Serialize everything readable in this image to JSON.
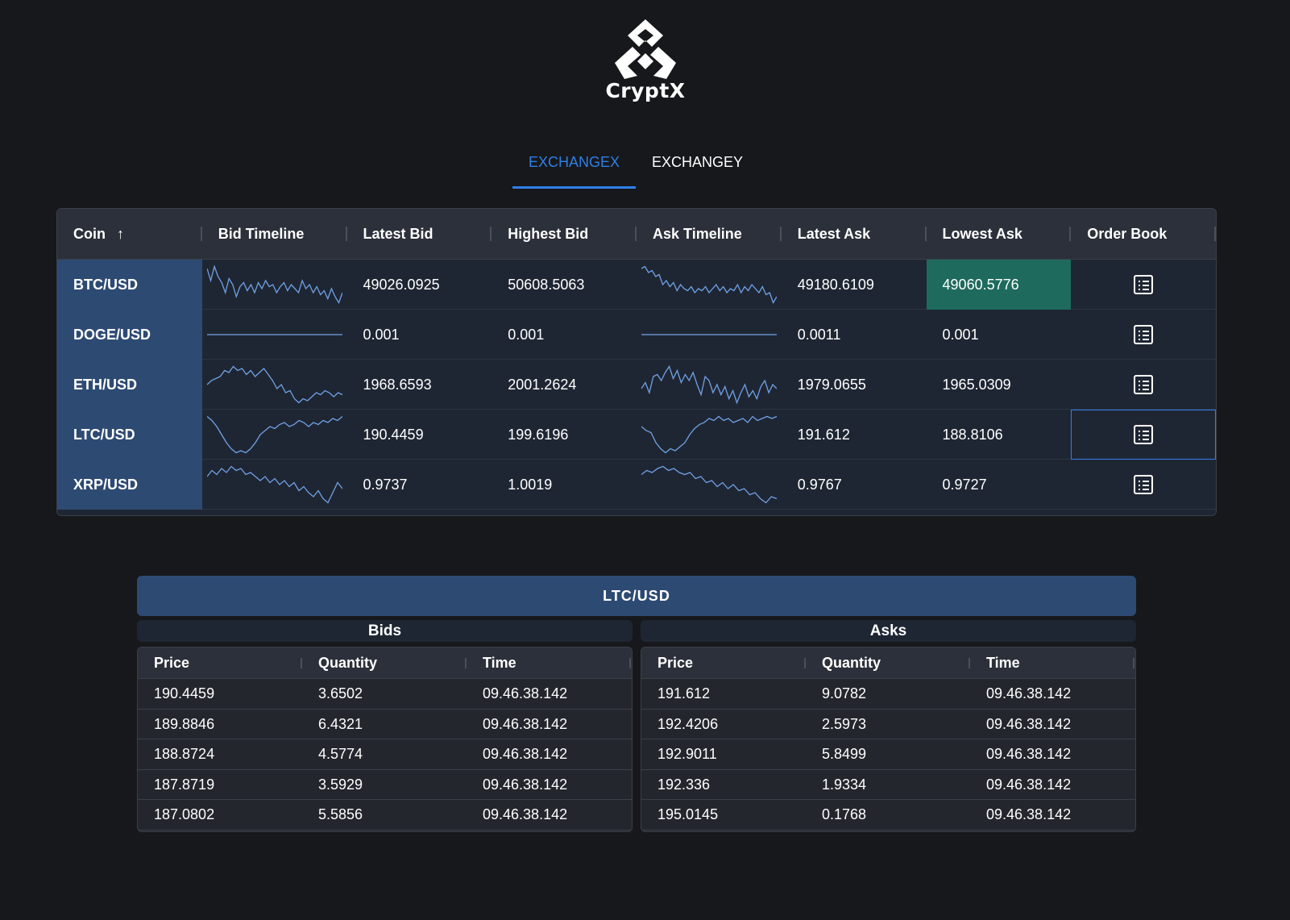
{
  "brand": {
    "name": "CryptX"
  },
  "tabs": [
    {
      "label": "EXCHANGEX",
      "active": true
    },
    {
      "label": "EXCHANGEY",
      "active": false
    }
  ],
  "grid": {
    "columns": [
      "Coin",
      "Bid Timeline",
      "Latest Bid",
      "Highest Bid",
      "Ask Timeline",
      "Latest Ask",
      "Lowest Ask",
      "Order Book"
    ],
    "sort": {
      "column": "Coin",
      "direction": "ascending"
    },
    "rows": [
      {
        "coin": "BTC/USD",
        "latest_bid": "49026.0925",
        "highest_bid": "50608.5063",
        "latest_ask": "49180.6109",
        "lowest_ask": "49060.5776",
        "lowest_ask_highlight": true,
        "bid_timeline": [
          0.9,
          0.6,
          0.95,
          0.7,
          0.55,
          0.3,
          0.65,
          0.5,
          0.2,
          0.45,
          0.55,
          0.35,
          0.5,
          0.3,
          0.55,
          0.4,
          0.6,
          0.45,
          0.5,
          0.3,
          0.45,
          0.55,
          0.35,
          0.5,
          0.4,
          0.3,
          0.6,
          0.4,
          0.5,
          0.3,
          0.45,
          0.25,
          0.35,
          0.15,
          0.4,
          0.2,
          0.05,
          0.3
        ],
        "ask_timeline": [
          0.9,
          0.95,
          0.8,
          0.85,
          0.7,
          0.75,
          0.5,
          0.6,
          0.45,
          0.55,
          0.35,
          0.5,
          0.4,
          0.35,
          0.45,
          0.3,
          0.4,
          0.35,
          0.45,
          0.3,
          0.4,
          0.5,
          0.35,
          0.45,
          0.3,
          0.4,
          0.35,
          0.5,
          0.3,
          0.45,
          0.35,
          0.5,
          0.4,
          0.3,
          0.45,
          0.25,
          0.3,
          0.05,
          0.2
        ]
      },
      {
        "coin": "DOGE/USD",
        "latest_bid": "0.001",
        "highest_bid": "0.001",
        "latest_ask": "0.0011",
        "lowest_ask": "0.001",
        "lowest_ask_highlight": false,
        "bid_timeline": [
          0.5,
          0.5,
          0.5,
          0.5,
          0.5,
          0.5,
          0.5,
          0.5,
          0.5,
          0.5
        ],
        "ask_timeline": [
          0.5,
          0.5,
          0.5,
          0.5,
          0.5,
          0.5,
          0.5,
          0.5,
          0.5,
          0.5
        ]
      },
      {
        "coin": "ETH/USD",
        "latest_bid": "1968.6593",
        "highest_bid": "2001.2624",
        "latest_ask": "1979.0655",
        "lowest_ask": "1965.0309",
        "lowest_ask_highlight": false,
        "bid_timeline": [
          0.5,
          0.6,
          0.65,
          0.7,
          0.85,
          0.8,
          0.95,
          0.85,
          0.9,
          0.75,
          0.85,
          0.7,
          0.8,
          0.9,
          0.75,
          0.6,
          0.4,
          0.5,
          0.3,
          0.35,
          0.15,
          0.05,
          0.15,
          0.1,
          0.2,
          0.3,
          0.25,
          0.35,
          0.3,
          0.2,
          0.3,
          0.25
        ],
        "ask_timeline": [
          0.4,
          0.55,
          0.3,
          0.7,
          0.75,
          0.6,
          0.8,
          0.95,
          0.65,
          0.85,
          0.55,
          0.75,
          0.6,
          0.8,
          0.5,
          0.25,
          0.7,
          0.6,
          0.3,
          0.5,
          0.25,
          0.45,
          0.15,
          0.35,
          0.05,
          0.3,
          0.5,
          0.2,
          0.35,
          0.15,
          0.45,
          0.6,
          0.3,
          0.5,
          0.4
        ]
      },
      {
        "coin": "LTC/USD",
        "latest_bid": "190.4459",
        "highest_bid": "199.6196",
        "latest_ask": "191.612",
        "lowest_ask": "188.8106",
        "lowest_ask_highlight": false,
        "selected": true,
        "bid_timeline": [
          0.95,
          0.85,
          0.7,
          0.5,
          0.3,
          0.15,
          0.05,
          0.1,
          0.05,
          0.15,
          0.3,
          0.5,
          0.6,
          0.7,
          0.65,
          0.75,
          0.8,
          0.7,
          0.75,
          0.85,
          0.8,
          0.7,
          0.8,
          0.75,
          0.85,
          0.8,
          0.9,
          0.85,
          0.95
        ],
        "ask_timeline": [
          0.7,
          0.6,
          0.55,
          0.3,
          0.15,
          0.05,
          0.15,
          0.1,
          0.2,
          0.3,
          0.5,
          0.65,
          0.75,
          0.8,
          0.9,
          0.85,
          0.95,
          0.85,
          0.9,
          0.8,
          0.85,
          0.9,
          0.8,
          0.95,
          0.85,
          0.9,
          0.95,
          0.9,
          0.95
        ]
      },
      {
        "coin": "XRP/USD",
        "latest_bid": "0.9737",
        "highest_bid": "1.0019",
        "latest_ask": "0.9767",
        "lowest_ask": "0.9727",
        "lowest_ask_highlight": false,
        "bid_timeline": [
          0.7,
          0.85,
          0.75,
          0.9,
          0.8,
          0.95,
          0.85,
          0.9,
          0.75,
          0.8,
          0.7,
          0.6,
          0.7,
          0.55,
          0.65,
          0.5,
          0.6,
          0.45,
          0.55,
          0.35,
          0.45,
          0.3,
          0.2,
          0.35,
          0.15,
          0.05,
          0.3,
          0.55,
          0.4
        ],
        "ask_timeline": [
          0.75,
          0.85,
          0.8,
          0.9,
          0.95,
          0.85,
          0.9,
          0.8,
          0.75,
          0.8,
          0.65,
          0.7,
          0.55,
          0.6,
          0.45,
          0.55,
          0.4,
          0.5,
          0.35,
          0.4,
          0.25,
          0.3,
          0.15,
          0.05,
          0.2,
          0.15
        ]
      }
    ]
  },
  "order_book": {
    "title": "LTC/USD",
    "bids": {
      "title": "Bids",
      "columns": [
        "Price",
        "Quantity",
        "Time"
      ],
      "rows": [
        [
          "190.4459",
          "3.6502",
          "09.46.38.142"
        ],
        [
          "189.8846",
          "6.4321",
          "09.46.38.142"
        ],
        [
          "188.8724",
          "4.5774",
          "09.46.38.142"
        ],
        [
          "187.8719",
          "3.5929",
          "09.46.38.142"
        ],
        [
          "187.0802",
          "5.5856",
          "09.46.38.142"
        ]
      ]
    },
    "asks": {
      "title": "Asks",
      "columns": [
        "Price",
        "Quantity",
        "Time"
      ],
      "rows": [
        [
          "191.612",
          "9.0782",
          "09.46.38.142"
        ],
        [
          "192.4206",
          "2.5973",
          "09.46.38.142"
        ],
        [
          "192.9011",
          "5.8499",
          "09.46.38.142"
        ],
        [
          "192.336",
          "1.9334",
          "09.46.38.142"
        ],
        [
          "195.0145",
          "0.1768",
          "09.46.38.142"
        ]
      ]
    }
  },
  "colors": {
    "accent": "#2f7fe8",
    "coin_cell": "#2d4a73",
    "highlight": "#1e6b5d",
    "sparkline": "#6fa2e6"
  },
  "icons": {
    "sort": "arrow-up-icon",
    "order_book": "list-icon"
  }
}
